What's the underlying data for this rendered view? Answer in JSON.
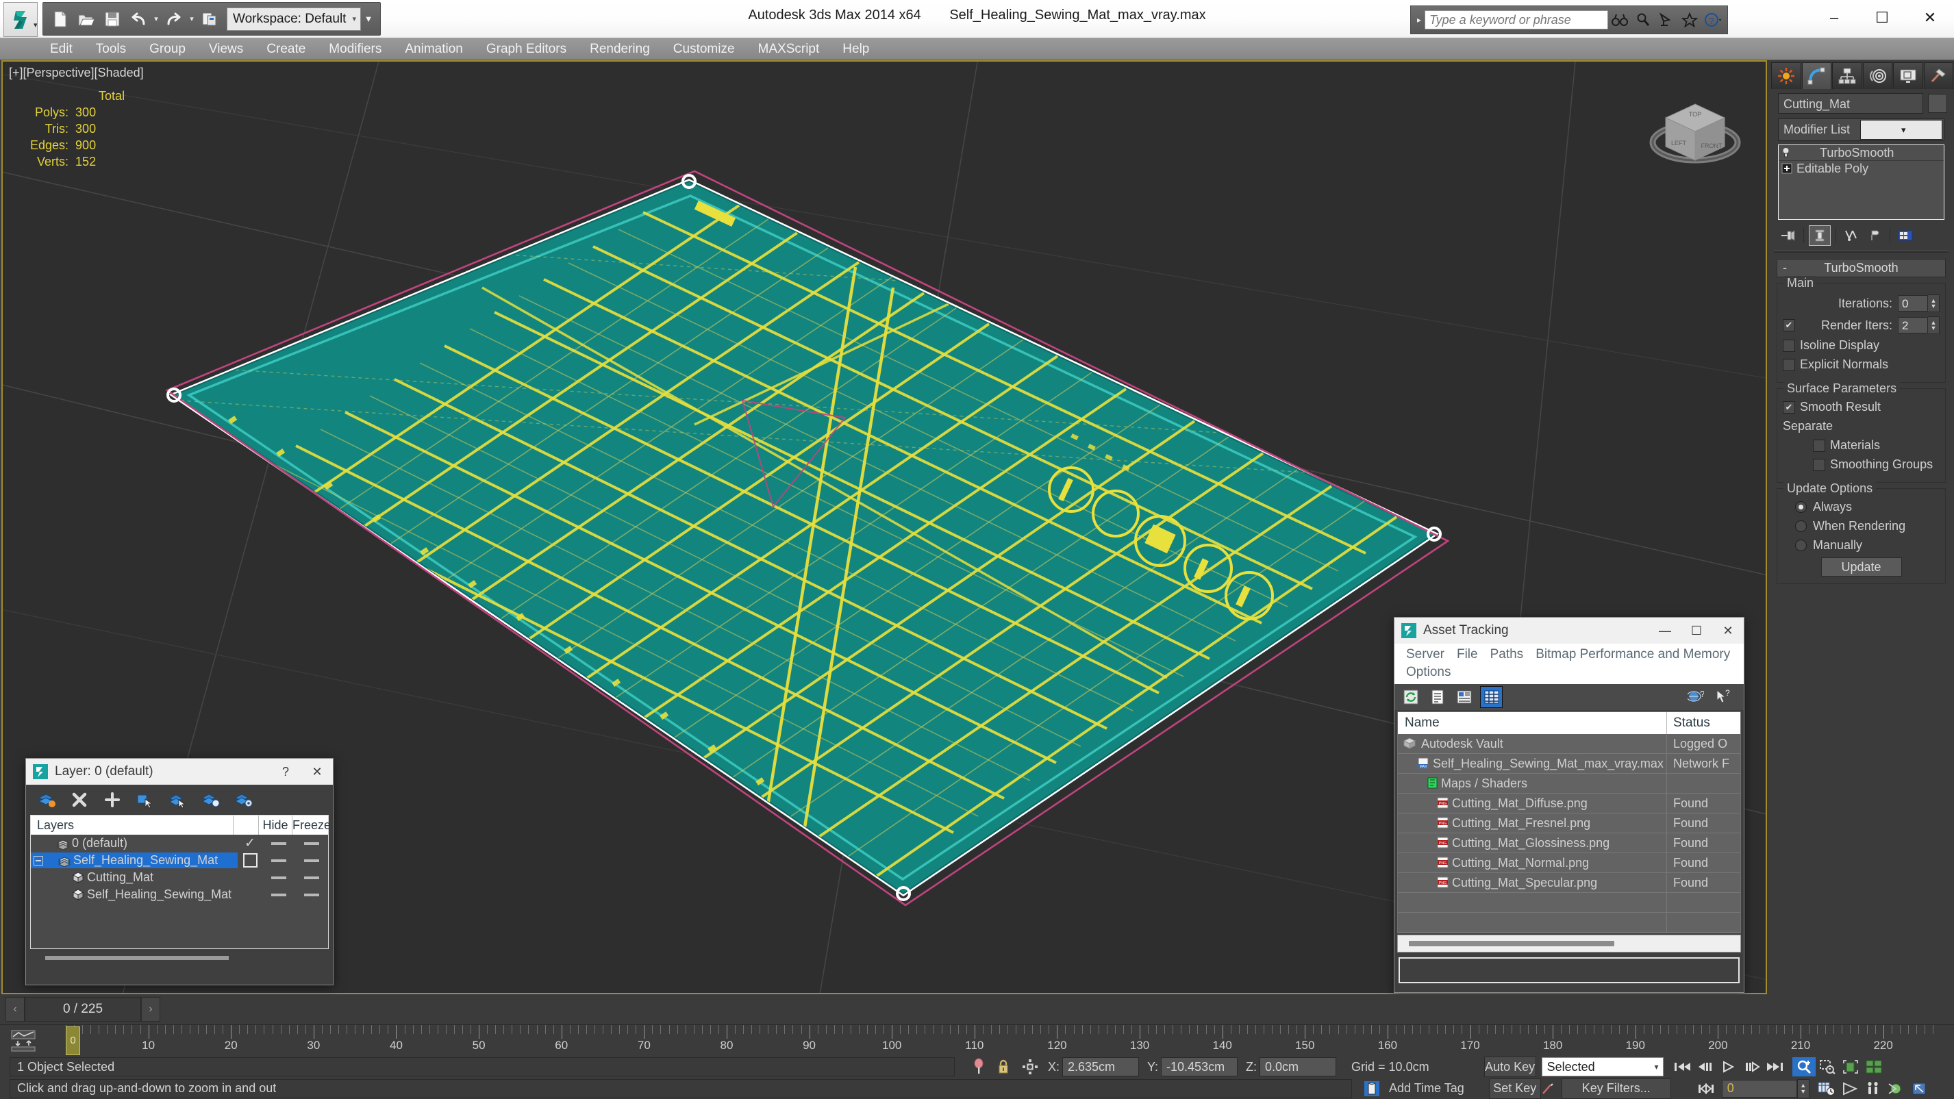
{
  "titlebar": {
    "app_title": "Autodesk 3ds Max  2014 x64",
    "file_name": "Self_Healing_Sewing_Mat_max_vray.max",
    "workspace": "Workspace: Default",
    "search_placeholder": "Type a keyword or phrase",
    "quick_access": [
      "new-icon",
      "open-icon",
      "save-icon",
      "undo-icon",
      "redo-icon",
      "set-project-icon"
    ],
    "search_icons": [
      "binoculars-icon",
      "magnifier-icon",
      "satellite-icon",
      "star-icon",
      "help-icon"
    ],
    "window_controls": [
      "minimize",
      "maximize",
      "close"
    ]
  },
  "menubar": {
    "items": [
      "Edit",
      "Tools",
      "Group",
      "Views",
      "Create",
      "Modifiers",
      "Animation",
      "Graph Editors",
      "Rendering",
      "Customize",
      "MAXScript",
      "Help"
    ]
  },
  "viewport": {
    "label": "[+][Perspective][Shaded]",
    "stats": {
      "header": "Total",
      "rows": [
        {
          "label": "Polys:",
          "value": "300"
        },
        {
          "label": "Tris:",
          "value": "300"
        },
        {
          "label": "Edges:",
          "value": "900"
        },
        {
          "label": "Verts:",
          "value": "152"
        }
      ]
    },
    "colors": {
      "mat_teal": "#13857f",
      "mat_line_yellow": "#e8e03c",
      "selection_white": "#ffffff",
      "gizmo_pink": "#c0447e",
      "background": "#2e2e2e"
    }
  },
  "command_panel": {
    "tabs": [
      "create-tab-icon",
      "modify-tab-icon",
      "hierarchy-tab-icon",
      "motion-tab-icon",
      "display-tab-icon",
      "utilities-tab-icon"
    ],
    "active_tab_index": 1,
    "object_name": "Cutting_Mat",
    "modifier_list_label": "Modifier List",
    "stack": [
      {
        "label": "TurboSmooth",
        "icon": "lightbulb-icon"
      },
      {
        "label": "Editable Poly",
        "icon": "plus-expand-icon"
      }
    ],
    "stack_tools": [
      "pin-stack-icon",
      "show-end-result-icon",
      "make-unique-icon",
      "remove-modifier-icon",
      "configure-sets-icon"
    ],
    "rollout": {
      "title": "TurboSmooth",
      "collapse_glyph": "-",
      "main_group": "Main",
      "iterations_label": "Iterations:",
      "iterations_value": "0",
      "render_iters_label": "Render Iters:",
      "render_iters_value": "2",
      "render_iters_checked": true,
      "isoline_label": "Isoline Display",
      "isoline_checked": false,
      "explicit_normals_label": "Explicit Normals",
      "explicit_normals_checked": false,
      "surface_group": "Surface Parameters",
      "smooth_result_label": "Smooth Result",
      "smooth_result_checked": true,
      "separate_label": "Separate",
      "materials_label": "Materials",
      "materials_checked": false,
      "smoothing_groups_label": "Smoothing Groups",
      "smoothing_groups_checked": false,
      "update_group": "Update Options",
      "update_options": [
        {
          "label": "Always",
          "selected": true
        },
        {
          "label": "When Rendering",
          "selected": false
        },
        {
          "label": "Manually",
          "selected": false
        }
      ],
      "update_button": "Update"
    }
  },
  "asset_tracking": {
    "title": "Asset Tracking",
    "menu": [
      "Server",
      "File",
      "Paths",
      "Bitmap Performance and Memory",
      "Options"
    ],
    "toolbar_icons": [
      "refresh-icon",
      "list-view-icon",
      "details-view-icon",
      "grid-view-icon"
    ],
    "help_icons": [
      "help-globe-icon",
      "help-pointer-icon"
    ],
    "columns": [
      "Name",
      "Status"
    ],
    "rows": [
      {
        "name": "Autodesk Vault",
        "status": "Logged O",
        "icon": "vault-icon",
        "indent": 1
      },
      {
        "name": "Self_Healing_Sewing_Mat_max_vray.max",
        "status": "Network F",
        "icon": "max-file-icon",
        "indent": 2
      },
      {
        "name": "Maps / Shaders",
        "status": "",
        "icon": "maps-icon",
        "indent": 3
      },
      {
        "name": "Cutting_Mat_Diffuse.png",
        "status": "Found",
        "icon": "png-icon",
        "indent": 4
      },
      {
        "name": "Cutting_Mat_Fresnel.png",
        "status": "Found",
        "icon": "png-icon",
        "indent": 4
      },
      {
        "name": "Cutting_Mat_Glossiness.png",
        "status": "Found",
        "icon": "png-icon",
        "indent": 4
      },
      {
        "name": "Cutting_Mat_Normal.png",
        "status": "Found",
        "icon": "png-icon",
        "indent": 4
      },
      {
        "name": "Cutting_Mat_Specular.png",
        "status": "Found",
        "icon": "png-icon",
        "indent": 4
      },
      {
        "name": "",
        "status": "",
        "icon": "",
        "indent": 0
      },
      {
        "name": "",
        "status": "",
        "icon": "",
        "indent": 0
      }
    ],
    "window_controls": [
      "minimize",
      "maximize",
      "close"
    ]
  },
  "layer_dialog": {
    "title": "Layer: 0 (default)",
    "help_glyph": "?",
    "close_glyph": "✕",
    "toolbar_icons": [
      "create-new-layer-icon",
      "delete-layer-icon",
      "add-selection-icon",
      "select-objects-in-layer-icon",
      "select-highlighted-objects-icon",
      "highlight-selected-objects-icon",
      "layer-properties-icon"
    ],
    "columns": [
      "Layers",
      "Hide",
      "Freeze"
    ],
    "rows": [
      {
        "name": "0 (default)",
        "icon": "layer-icon",
        "indent": 1,
        "current": true,
        "selected": false,
        "expander": ""
      },
      {
        "name": "Self_Healing_Sewing_Mat",
        "icon": "layer-icon",
        "indent": 1,
        "current": false,
        "selected": true,
        "expander": "-"
      },
      {
        "name": "Cutting_Mat",
        "icon": "object-icon",
        "indent": 2,
        "current": false,
        "selected": false,
        "expander": ""
      },
      {
        "name": "Self_Healing_Sewing_Mat",
        "icon": "object-icon",
        "indent": 2,
        "current": false,
        "selected": false,
        "expander": ""
      }
    ]
  },
  "timeline": {
    "frame_display": "0 / 225",
    "prev_glyph": "‹",
    "next_glyph": "›",
    "current_frame": 0,
    "ticks": [
      0,
      10,
      20,
      30,
      40,
      50,
      60,
      70,
      80,
      90,
      100,
      110,
      120,
      130,
      140,
      150,
      160,
      170,
      180,
      190,
      200,
      210,
      220
    ]
  },
  "status_bar": {
    "selection_text": "1 Object Selected",
    "prompt_text": "Click and drag up-and-down to zoom in and out",
    "coords": [
      {
        "axis": "X:",
        "value": "2.635cm"
      },
      {
        "axis": "Y:",
        "value": "-10.453cm"
      },
      {
        "axis": "Z:",
        "value": "0.0cm"
      }
    ],
    "grid_text": "Grid = 10.0cm",
    "add_time_tag": "Add Time Tag",
    "auto_key": "Auto Key",
    "set_key": "Set Key",
    "key_filters": "Key Filters...",
    "selected_combo": "Selected",
    "key_field_value": "0",
    "icons": [
      "pin-icon",
      "lock-icon",
      "isolate-icon",
      "time-tag-icon",
      "key-mode-icon"
    ],
    "playback_icons": [
      "go-to-start-icon",
      "prev-frame-icon",
      "play-icon",
      "next-frame-icon",
      "go-to-end-icon"
    ],
    "nav_icons": [
      "zoom-icon",
      "zoom-region-icon",
      "zoom-extents-icon",
      "zoom-extents-all-icon",
      "pan-icon",
      "orbit-icon",
      "walkthrough-icon",
      "field-of-view-icon",
      "maximize-viewport-icon"
    ]
  }
}
